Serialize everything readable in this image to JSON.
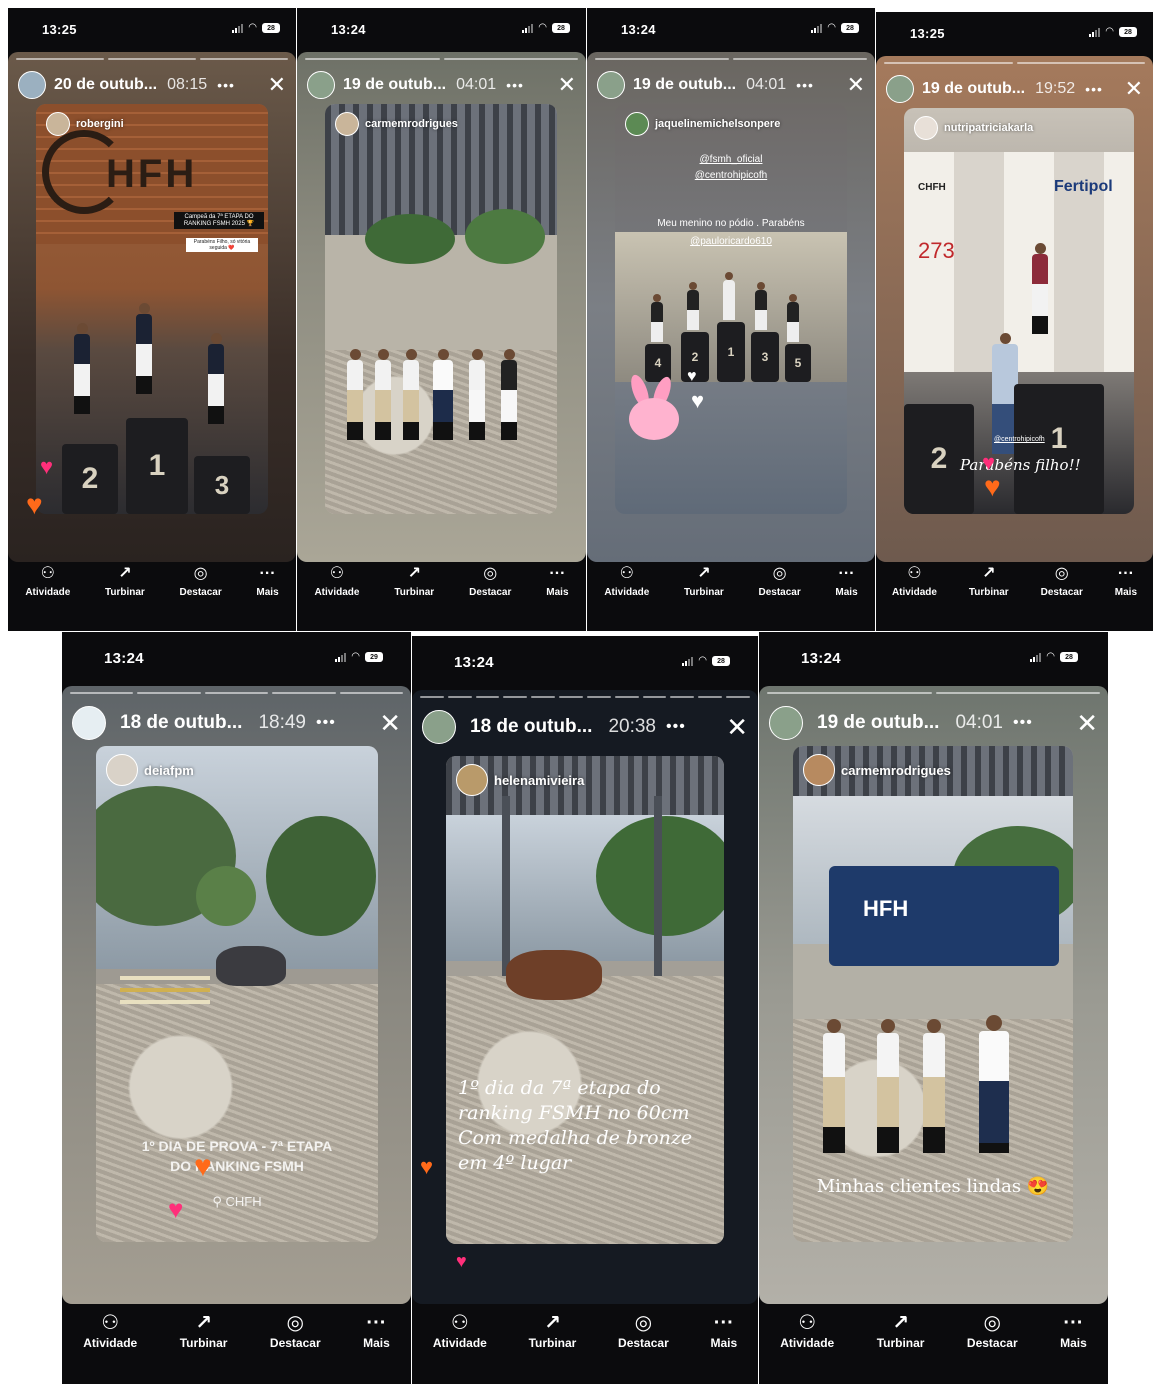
{
  "status_bar": {
    "signal_icon": "signal-icon",
    "wifi_icon": "wifi-icon",
    "battery_icon": "battery-icon"
  },
  "nav_labels": [
    "Atividade",
    "Turbinar",
    "Destacar",
    "Mais"
  ],
  "stories": [
    {
      "status_time": "13:25",
      "battery": "28",
      "date": "20 de outub...",
      "time": "08:15",
      "owner": "robergini",
      "texts": [
        "HFH",
        "Campeã da 7ª ETAPA DO RANKING FSMH 2025 🏆",
        "Parabéns Filho, só vitória seguida ❤️"
      ],
      "podium": [
        "2",
        "1",
        "3"
      ]
    },
    {
      "status_time": "13:24",
      "battery": "28",
      "date": "19 de outub...",
      "time": "04:01",
      "owner": "carmemrodrigues",
      "texts": []
    },
    {
      "status_time": "13:24",
      "battery": "28",
      "date": "19 de outub...",
      "time": "04:01",
      "owner": "jaquelinemichelsonpere",
      "texts": [
        "@fsmh_oficial",
        "@centrohipicofh",
        "Meu menino no pódio . Parabéns",
        "@pauloricardo610"
      ],
      "podium": [
        "4",
        "2",
        "1",
        "3",
        "5"
      ]
    },
    {
      "status_time": "13:25",
      "battery": "28",
      "date": "19 de outub...",
      "time": "19:52",
      "owner": "nutripatriciakarla",
      "texts": [
        "CHFH",
        "Fertipol",
        "273",
        "Parabéns filho!!",
        "@centrohipicofh"
      ],
      "podium": [
        "2",
        "1"
      ]
    },
    {
      "status_time": "13:24",
      "battery": "29",
      "date": "18 de outub...",
      "time": "18:49",
      "owner": "deiafpm",
      "texts": [
        "1º DIA DE PROVA - 7ª ETAPA",
        "DO RANKING FSMH",
        "CHFH"
      ]
    },
    {
      "status_time": "13:24",
      "battery": "28",
      "date": "18 de outub...",
      "time": "20:38",
      "owner": "helenamivieira",
      "texts": [
        "1º dia da 7ª etapa do ranking FSMH no 60cm Com medalha de bronze em 4º lugar"
      ]
    },
    {
      "status_time": "13:24",
      "battery": "28",
      "date": "19 de outub...",
      "time": "04:01",
      "owner": "carmemrodrigues",
      "texts": [
        "HFH",
        "Minhas clientes lindas 😍"
      ]
    }
  ],
  "nav_icons": [
    "activity-icon",
    "boost-icon",
    "highlight-icon",
    "more-icon"
  ],
  "colors": {
    "phone_bg": "#0b0b0d",
    "heart_pink": "#ff2f7a",
    "heart_orange": "#ff6a1a"
  }
}
